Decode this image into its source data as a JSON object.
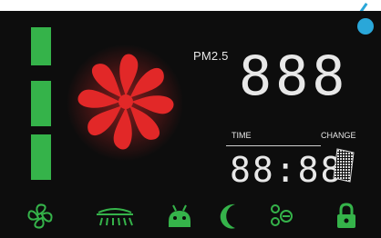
{
  "pm25_label": "PM2.5",
  "pm25_value": "888",
  "time_label": "TIME",
  "change_label": "CHANGE",
  "time_value": "88:88",
  "colors": {
    "background": "#0d0d0d",
    "accent_green": "#35b34a",
    "fan_red": "#e22828",
    "segment_white": "#e8e8e8",
    "corner_blue": "#2aa7d9"
  },
  "icons": [
    "fan-icon",
    "heater-icon",
    "ion-icon",
    "moon-icon",
    "dots-icon",
    "lock-icon"
  ],
  "level_indicators": 3
}
